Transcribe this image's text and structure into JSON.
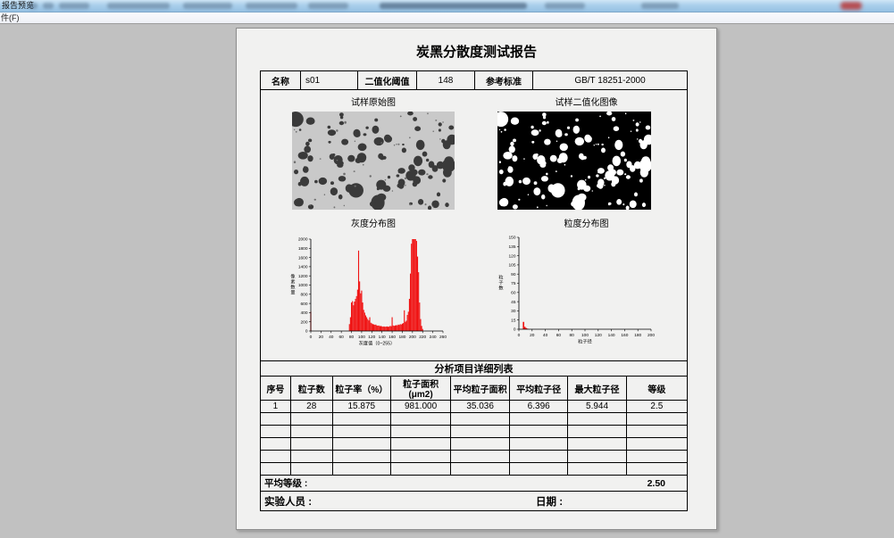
{
  "window": {
    "titlebar_app_label": "报告预览",
    "menu_file_label": "件(F)"
  },
  "report": {
    "title": "炭黑分散度测试报告",
    "info": {
      "name_label": "名称",
      "name_value": "s01",
      "threshold_label": "二值化阈值",
      "threshold_value": "148",
      "standard_label": "参考标准",
      "standard_value": "GB/T 18251-2000"
    },
    "captions": {
      "original_image": "试样原始图",
      "binary_image": "试样二值化图像",
      "gray_chart": "灰度分布图",
      "particle_chart": "粒度分布图"
    },
    "analysis": {
      "section_title": "分析项目详细列表",
      "columns": [
        "序号",
        "粒子数",
        "粒子率（%）",
        "粒子面积(μm2)",
        "平均粒子面积",
        "平均粒子径",
        "最大粒子径",
        "等级"
      ],
      "rows": [
        [
          "1",
          "28",
          "15.875",
          "981.000",
          "35.036",
          "6.396",
          "5.944",
          "2.5"
        ]
      ],
      "empty_row_count": 5
    },
    "summary": {
      "avg_grade_label": "平均等级 :",
      "avg_grade_value": "2.50",
      "operator_label": "实验人员 :",
      "date_label": "日期 :"
    }
  },
  "colors": {
    "bar_red": "#f01010",
    "titlebar_blue": "#aacfeb",
    "page_bg": "#f1f1f0",
    "workspace_gray": "#c1c1c1",
    "sample_bg_gray": "#c9c9c9",
    "binary_bg": "#000000"
  },
  "chart_data": [
    {
      "type": "bar",
      "title": "灰度分布图",
      "xlabel": "灰度值（0~255）",
      "ylabel": "像素数量",
      "xlim": [
        0,
        260
      ],
      "ylim": [
        0,
        2000
      ],
      "xticks": [
        0,
        20,
        40,
        60,
        80,
        100,
        120,
        140,
        160,
        180,
        200,
        220,
        240,
        260
      ],
      "yticks": [
        0,
        200,
        400,
        600,
        800,
        1000,
        1200,
        1400,
        1600,
        1800,
        2000
      ],
      "grid": false,
      "legend": null,
      "bar_width": 1.1,
      "points": [
        [
          0,
          420
        ],
        [
          76,
          150
        ],
        [
          78,
          300
        ],
        [
          80,
          620
        ],
        [
          82,
          650
        ],
        [
          84,
          560
        ],
        [
          86,
          640
        ],
        [
          88,
          700
        ],
        [
          90,
          760
        ],
        [
          92,
          900
        ],
        [
          94,
          1750
        ],
        [
          96,
          1080
        ],
        [
          98,
          820
        ],
        [
          100,
          880
        ],
        [
          102,
          620
        ],
        [
          104,
          460
        ],
        [
          106,
          400
        ],
        [
          108,
          340
        ],
        [
          110,
          300
        ],
        [
          112,
          260
        ],
        [
          114,
          230
        ],
        [
          116,
          300
        ],
        [
          118,
          180
        ],
        [
          120,
          165
        ],
        [
          122,
          150
        ],
        [
          124,
          145
        ],
        [
          126,
          135
        ],
        [
          128,
          140
        ],
        [
          130,
          120
        ],
        [
          132,
          115
        ],
        [
          134,
          120
        ],
        [
          136,
          105
        ],
        [
          138,
          110
        ],
        [
          140,
          100
        ],
        [
          142,
          95
        ],
        [
          144,
          100
        ],
        [
          146,
          92
        ],
        [
          148,
          96
        ],
        [
          150,
          100
        ],
        [
          152,
          92
        ],
        [
          154,
          96
        ],
        [
          156,
          110
        ],
        [
          158,
          104
        ],
        [
          160,
          300
        ],
        [
          162,
          120
        ],
        [
          164,
          112
        ],
        [
          166,
          120
        ],
        [
          168,
          128
        ],
        [
          170,
          122
        ],
        [
          172,
          140
        ],
        [
          174,
          132
        ],
        [
          176,
          150
        ],
        [
          178,
          142
        ],
        [
          180,
          160
        ],
        [
          182,
          172
        ],
        [
          184,
          450
        ],
        [
          186,
          200
        ],
        [
          188,
          225
        ],
        [
          190,
          350
        ],
        [
          192,
          420
        ],
        [
          194,
          700
        ],
        [
          196,
          1250
        ],
        [
          198,
          1900
        ],
        [
          200,
          2000
        ],
        [
          202,
          2000
        ],
        [
          204,
          2000
        ],
        [
          206,
          2000
        ],
        [
          208,
          1960
        ],
        [
          210,
          1620
        ],
        [
          212,
          1280
        ],
        [
          214,
          620
        ],
        [
          216,
          260
        ],
        [
          218,
          110
        ],
        [
          220,
          45
        ]
      ]
    },
    {
      "type": "bar",
      "title": "粒度分布图",
      "xlabel": "粒子径",
      "ylabel": "粒子数",
      "xlim": [
        0,
        200
      ],
      "ylim": [
        0,
        150
      ],
      "xticks": [
        0,
        20,
        40,
        60,
        80,
        100,
        120,
        140,
        160,
        180,
        200
      ],
      "yticks": [
        0,
        15,
        30,
        45,
        60,
        75,
        90,
        105,
        120,
        135,
        150
      ],
      "grid": false,
      "legend": null,
      "bar_width": 1.6,
      "points": [
        [
          7,
          12
        ],
        [
          9,
          4
        ],
        [
          11,
          2
        ],
        [
          13,
          1
        ]
      ]
    }
  ]
}
